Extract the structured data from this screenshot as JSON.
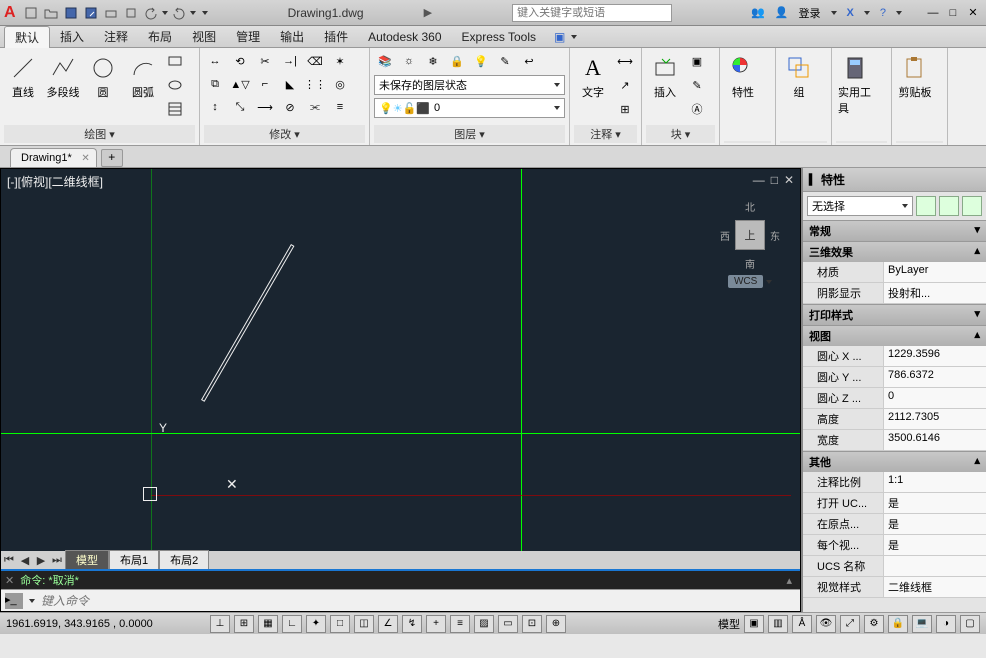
{
  "titlebar": {
    "doc_title": "Drawing1.dwg",
    "search_placeholder": "键入关键字或短语",
    "login": "登录"
  },
  "menu": {
    "tabs": [
      "默认",
      "插入",
      "注释",
      "布局",
      "视图",
      "管理",
      "输出",
      "插件",
      "Autodesk 360",
      "Express Tools"
    ]
  },
  "ribbon": {
    "draw": {
      "title": "绘图",
      "line": "直线",
      "polyline": "多段线",
      "circle": "圆",
      "arc": "圆弧"
    },
    "modify": {
      "title": "修改"
    },
    "layers": {
      "title": "图层",
      "unsaved": "未保存的图层状态",
      "zero": "0"
    },
    "annotation": {
      "title": "注释",
      "text": "文字"
    },
    "block": {
      "title": "块",
      "insert": "插入"
    },
    "properties": {
      "title": "特性"
    },
    "group": {
      "title": "组"
    },
    "utils": {
      "title": "实用工具"
    },
    "clipboard": {
      "title": "剪贴板"
    }
  },
  "file_tab": "Drawing1*",
  "viewport": {
    "label": "[-][俯视][二维线框]",
    "wcs": "WCS",
    "top": "上",
    "n": "北",
    "s": "南",
    "e": "东",
    "w": "西"
  },
  "draw_tabs": {
    "model": "模型",
    "layout1": "布局1",
    "layout2": "布局2"
  },
  "cmd": {
    "history": "命令: *取消*",
    "placeholder": "键入命令"
  },
  "props": {
    "title": "特性",
    "noselect": "无选择",
    "cats": {
      "general": "常规",
      "d3": "三维效果",
      "plot": "打印样式",
      "view": "视图",
      "misc": "其他"
    },
    "material": {
      "n": "材质",
      "v": "ByLayer"
    },
    "shadow": {
      "n": "阴影显示",
      "v": "投射和..."
    },
    "cx": {
      "n": "圆心 X ...",
      "v": "1229.3596"
    },
    "cy": {
      "n": "圆心 Y ...",
      "v": "786.6372"
    },
    "cz": {
      "n": "圆心 Z ...",
      "v": "0"
    },
    "height": {
      "n": "高度",
      "v": "2112.7305"
    },
    "width": {
      "n": "宽度",
      "v": "3500.6146"
    },
    "annoscale": {
      "n": "注释比例",
      "v": "1:1"
    },
    "openucs": {
      "n": "打开 UC...",
      "v": "是"
    },
    "atorigin": {
      "n": "在原点...",
      "v": "是"
    },
    "eachview": {
      "n": "每个视...",
      "v": "是"
    },
    "ucsname": {
      "n": "UCS 名称",
      "v": ""
    },
    "visualstyle": {
      "n": "视觉样式",
      "v": "二维线框"
    }
  },
  "status": {
    "coords": "1961.6919, 343.9165 , 0.0000",
    "modelspace": "模型"
  }
}
